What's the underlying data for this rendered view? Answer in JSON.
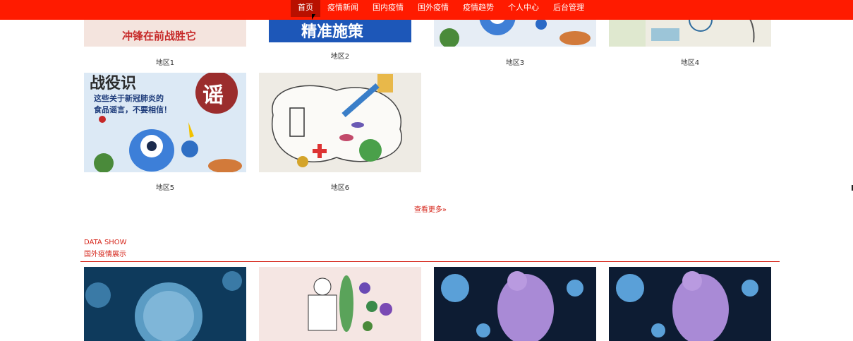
{
  "nav": {
    "items": [
      "首页",
      "疫情新闻",
      "国内疫情",
      "国外疫情",
      "疫情趋势",
      "个人中心",
      "后台管理"
    ],
    "active": "首页"
  },
  "domestic": {
    "cards": [
      {
        "caption": "地区1",
        "image_text": "冲锋在前战胜它"
      },
      {
        "caption": "地区2",
        "image_text": "精准施策"
      },
      {
        "caption": "地区3"
      },
      {
        "caption": "地区4"
      },
      {
        "caption": "地区5",
        "image_text_1": "战役识",
        "image_text_2": "谣",
        "image_text_3": "这些关于新冠肺炎的",
        "image_text_4": "食品谣言，不要相信！"
      },
      {
        "caption": "地区6"
      }
    ],
    "more": "查看更多»"
  },
  "foreign_section": {
    "title_en": "DATA SHOW",
    "title_cn": "国外疫情展示"
  },
  "colors": {
    "nav_bg": "#ff1b00",
    "nav_active": "#b81000",
    "accent": "#d6271c"
  }
}
